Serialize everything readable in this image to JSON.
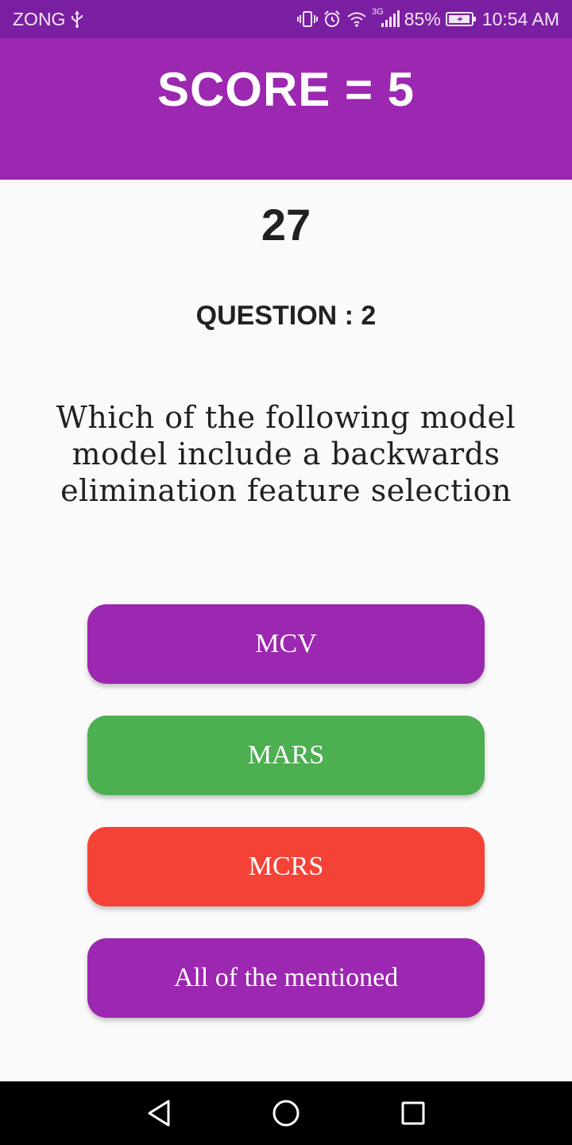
{
  "status_bar": {
    "carrier": "ZONG",
    "network_type": "3G",
    "battery": "85%",
    "time": "10:54 AM",
    "icons": [
      "usb-icon",
      "vibrate-icon",
      "alarm-icon",
      "wifi-icon",
      "signal-icon",
      "battery-icon"
    ]
  },
  "header": {
    "score_title": "SCORE = 5",
    "background_color": "#9c27b0"
  },
  "quiz": {
    "timer": "27",
    "question_number": "QUESTION : 2",
    "question_text": "Which of the following model model include a backwards elimination feature selection",
    "options": [
      {
        "label": "MCV",
        "color": "#9c27b0"
      },
      {
        "label": "MARS",
        "color": "#4caf50"
      },
      {
        "label": "MCRS",
        "color": "#f44336"
      },
      {
        "label": "All of the mentioned",
        "color": "#9c27b0"
      }
    ]
  },
  "nav_bar": {
    "icons": [
      "back-icon",
      "home-icon",
      "recents-icon"
    ]
  }
}
